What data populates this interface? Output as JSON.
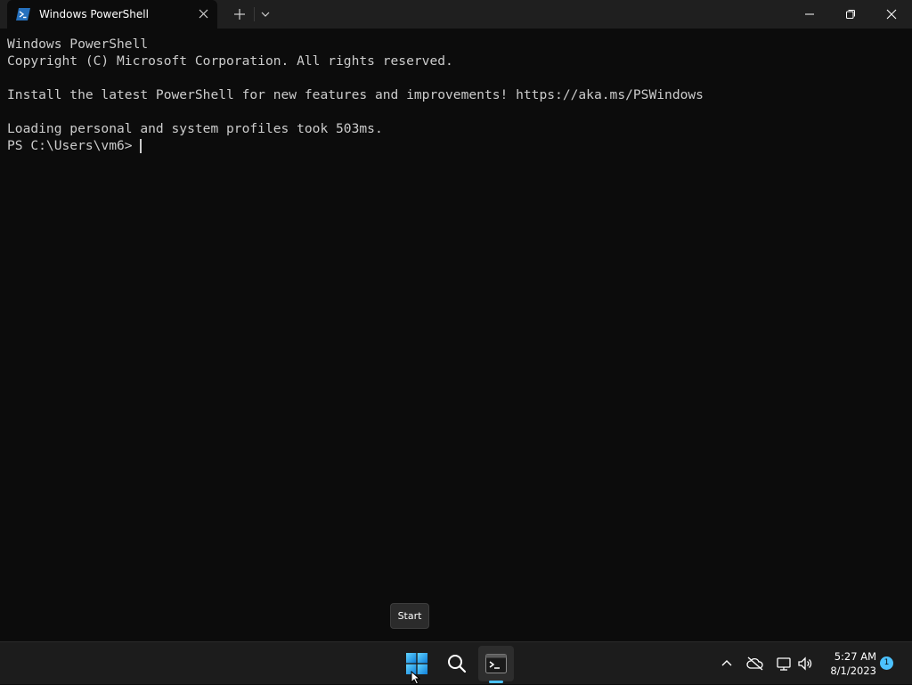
{
  "window": {
    "tab_title": "Windows PowerShell",
    "tab_icon": "powershell-icon",
    "close_tab_icon": "close-icon",
    "new_tab_icon": "plus-icon",
    "dropdown_icon": "chevron-down-icon",
    "controls": [
      "minimize-icon",
      "restore-icon",
      "close-icon"
    ]
  },
  "terminal": {
    "lines": [
      "Windows PowerShell",
      "Copyright (C) Microsoft Corporation. All rights reserved.",
      "",
      "Install the latest PowerShell for new features and improvements! https://aka.ms/PSWindows",
      "",
      "Loading personal and system profiles took 503ms."
    ],
    "prompt": "PS C:\\Users\\vm6>",
    "background": "#0c0c0c",
    "foreground": "#cccccc"
  },
  "tooltip": {
    "text": "Start"
  },
  "taskbar": {
    "items": [
      "windows-start-icon",
      "search-icon",
      "terminal-icon"
    ],
    "tray_icons": [
      "chevron-up-icon",
      "cloud-offline-icon",
      "network-icon",
      "volume-icon"
    ],
    "time": "5:27 AM",
    "date": "8/1/2023",
    "notification_count": "1",
    "accent": "#4cc2ff"
  }
}
